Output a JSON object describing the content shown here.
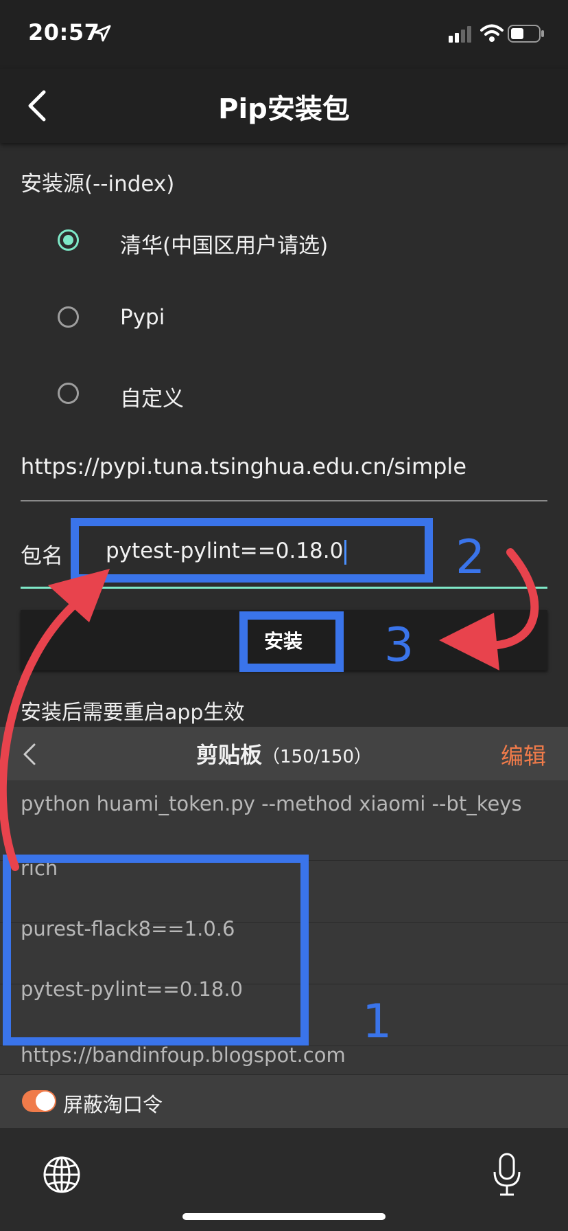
{
  "status_bar": {
    "time": "20:57"
  },
  "nav": {
    "title": "Pip安装包"
  },
  "form": {
    "index_label": "安装源(--index)",
    "sources": [
      {
        "label": "清华(中国区用户请选)",
        "selected": true
      },
      {
        "label": "Pypi",
        "selected": false
      },
      {
        "label": "自定义",
        "selected": false
      }
    ],
    "index_url": "https://pypi.tuna.tsinghua.edu.cn/simple",
    "package_label": "包名",
    "package_value": "pytest-pylint==0.18.0",
    "install_label": "安装",
    "note": "安装后需要重启app生效"
  },
  "clipboard": {
    "title": "剪贴板",
    "count": "（150/150）",
    "edit_label": "编辑",
    "items": [
      "python huami_token.py --method xiaomi --bt_keys",
      "rich",
      "purest-flack8==1.0.6",
      "pytest-pylint==0.18.0",
      "https://bandinfoup.blogspot.com"
    ],
    "toggle_label": "屏蔽淘口令",
    "toggle_on": true
  },
  "annotations": {
    "step1": "1",
    "step2": "2",
    "step3": "3"
  },
  "colors": {
    "accent_teal": "#7ee8c7",
    "accent_orange": "#f07b4a",
    "annotation_blue": "#3a74ea",
    "annotation_red": "#e8434d"
  }
}
